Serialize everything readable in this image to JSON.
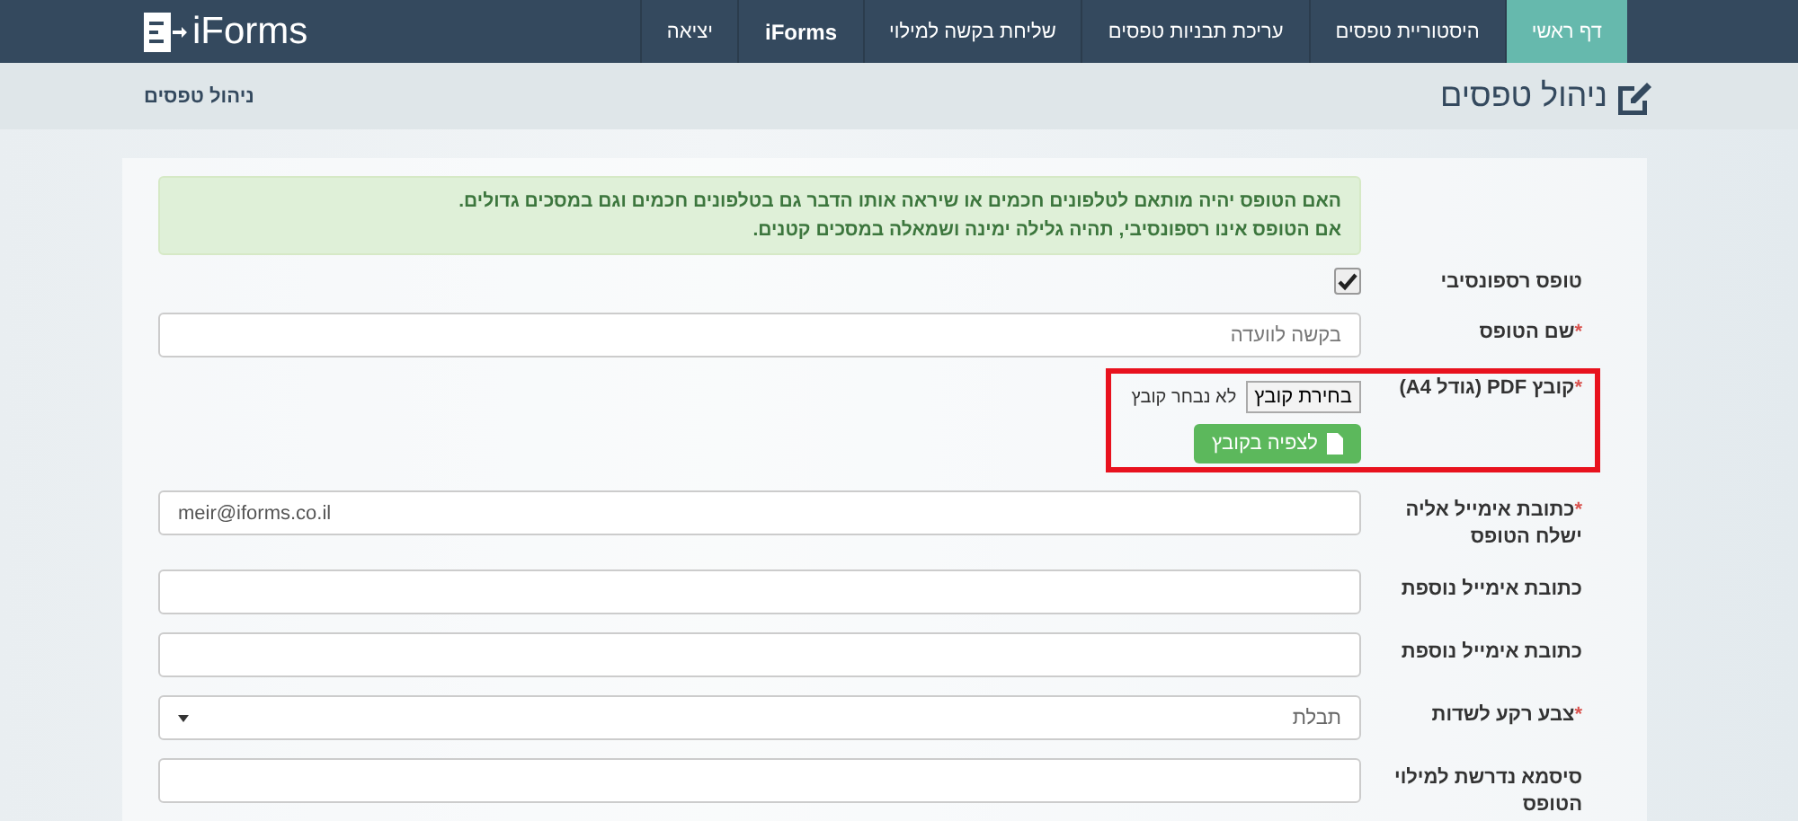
{
  "navbar": {
    "logo": "iForms",
    "tabs": [
      {
        "label": "דף ראשי",
        "selected": true,
        "bold": false
      },
      {
        "label": "היסטוריית טפסים",
        "selected": false,
        "bold": false
      },
      {
        "label": "עריכת תבניות טפסים",
        "selected": false,
        "bold": false
      },
      {
        "label": "שליחת בקשה למילוי",
        "selected": false,
        "bold": false
      },
      {
        "label": "iForms",
        "selected": false,
        "bold": true
      },
      {
        "label": "יציאה",
        "selected": false,
        "bold": false
      }
    ]
  },
  "header": {
    "title": "ניהול טפסים",
    "breadcrumb": "ניהול טפסים"
  },
  "form": {
    "rows": [
      {
        "kind": "alert",
        "lines": [
          "האם הטופס יהיה מותאם לטלפונים חכמים או שיראה אותו הדבר גם בטלפונים חכמים וגם במסכים גדולים.",
          "אם הטופס אינו רספונסיבי, תהיה גלילה ימינה ושמאלה במסכים קטנים."
        ]
      },
      {
        "kind": "checkbox",
        "label": "טופס רספונסיבי",
        "checked": true
      },
      {
        "kind": "text",
        "label": "שם הטופס",
        "required_mark": "*",
        "placeholder": "בקשה לוועדה"
      },
      {
        "kind": "file",
        "label": "קובץ PDF (גודל A4)",
        "required_mark": "*",
        "highlighted": true,
        "choose": "בחירת קובץ",
        "status": "לא נבחר קובץ",
        "view": "לצפיה בקובץ"
      },
      {
        "kind": "text",
        "label": "כתובת אימייל אליה ישלח הטופס",
        "required_mark": "*",
        "value": "meir@iforms.co.il"
      },
      {
        "kind": "text",
        "label": "כתובת אימייל נוספת"
      },
      {
        "kind": "text",
        "label": "כתובת אימייל נוספת"
      },
      {
        "kind": "select",
        "label": "צבע רקע לשדות",
        "required_mark": "*",
        "value": "תבלת"
      },
      {
        "kind": "text",
        "label": "סיסמא נדרשת למילוי הטופס"
      }
    ]
  }
}
